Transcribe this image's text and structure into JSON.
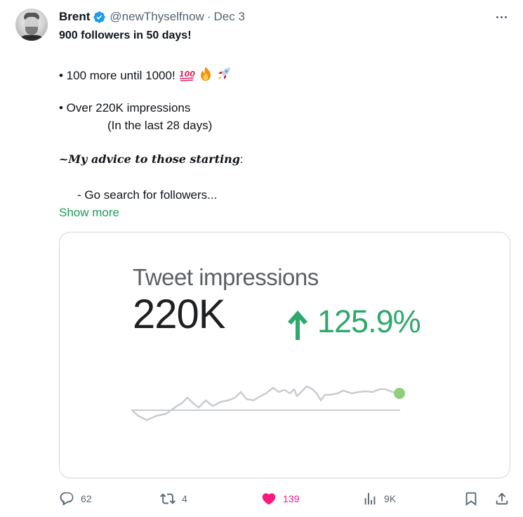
{
  "tweet": {
    "author_name": "Brent",
    "handle": "@newThyselfnow",
    "separator": "·",
    "date": "Dec 3",
    "headline": "900 followers in 50 days!",
    "line1": "• 100 more until 1000!",
    "line2": "• Over 220K impressions",
    "line3": "(In the last 28 days)",
    "advice_label": "~My advice to those starting",
    "advice_colon": ":",
    "line4": "- Go search for followers...",
    "show_more": "Show more"
  },
  "card": {
    "title": "Tweet impressions",
    "value": "220K",
    "change": "125.9%"
  },
  "actions": {
    "replies": "62",
    "retweets": "4",
    "likes": "139",
    "views": "9K"
  },
  "colors": {
    "verified_blue": "#1d9bf0",
    "like_pink": "#f91880",
    "show_more_green": "#1a9e56",
    "trend_green": "#2ea96b"
  },
  "icons": [
    "verified-icon",
    "more-icon",
    "hundred-icon",
    "fire-icon",
    "rocket-icon",
    "arrow-up-icon",
    "reply-icon",
    "retweet-icon",
    "heart-icon",
    "views-icon",
    "bookmark-icon",
    "share-icon"
  ]
}
